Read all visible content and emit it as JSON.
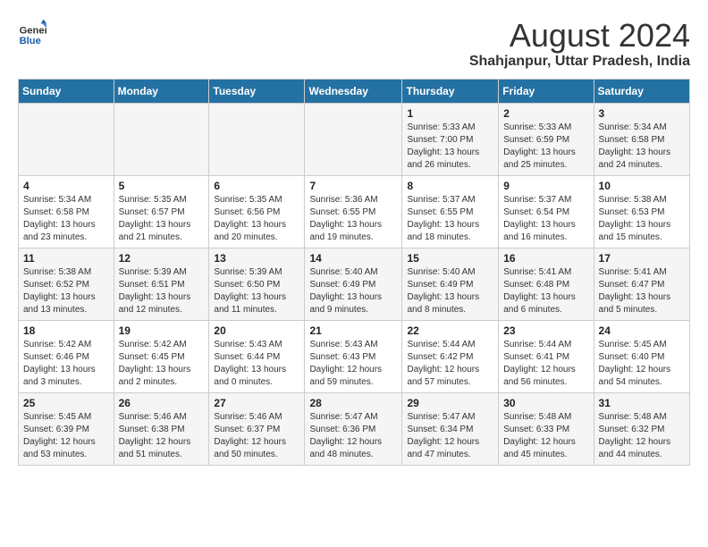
{
  "logo": {
    "text_general": "General",
    "text_blue": "Blue"
  },
  "title": "August 2024",
  "subtitle": "Shahjanpur, Uttar Pradesh, India",
  "days_of_week": [
    "Sunday",
    "Monday",
    "Tuesday",
    "Wednesday",
    "Thursday",
    "Friday",
    "Saturday"
  ],
  "weeks": [
    [
      {
        "day": "",
        "info": ""
      },
      {
        "day": "",
        "info": ""
      },
      {
        "day": "",
        "info": ""
      },
      {
        "day": "",
        "info": ""
      },
      {
        "day": "1",
        "info": "Sunrise: 5:33 AM\nSunset: 7:00 PM\nDaylight: 13 hours\nand 26 minutes."
      },
      {
        "day": "2",
        "info": "Sunrise: 5:33 AM\nSunset: 6:59 PM\nDaylight: 13 hours\nand 25 minutes."
      },
      {
        "day": "3",
        "info": "Sunrise: 5:34 AM\nSunset: 6:58 PM\nDaylight: 13 hours\nand 24 minutes."
      }
    ],
    [
      {
        "day": "4",
        "info": "Sunrise: 5:34 AM\nSunset: 6:58 PM\nDaylight: 13 hours\nand 23 minutes."
      },
      {
        "day": "5",
        "info": "Sunrise: 5:35 AM\nSunset: 6:57 PM\nDaylight: 13 hours\nand 21 minutes."
      },
      {
        "day": "6",
        "info": "Sunrise: 5:35 AM\nSunset: 6:56 PM\nDaylight: 13 hours\nand 20 minutes."
      },
      {
        "day": "7",
        "info": "Sunrise: 5:36 AM\nSunset: 6:55 PM\nDaylight: 13 hours\nand 19 minutes."
      },
      {
        "day": "8",
        "info": "Sunrise: 5:37 AM\nSunset: 6:55 PM\nDaylight: 13 hours\nand 18 minutes."
      },
      {
        "day": "9",
        "info": "Sunrise: 5:37 AM\nSunset: 6:54 PM\nDaylight: 13 hours\nand 16 minutes."
      },
      {
        "day": "10",
        "info": "Sunrise: 5:38 AM\nSunset: 6:53 PM\nDaylight: 13 hours\nand 15 minutes."
      }
    ],
    [
      {
        "day": "11",
        "info": "Sunrise: 5:38 AM\nSunset: 6:52 PM\nDaylight: 13 hours\nand 13 minutes."
      },
      {
        "day": "12",
        "info": "Sunrise: 5:39 AM\nSunset: 6:51 PM\nDaylight: 13 hours\nand 12 minutes."
      },
      {
        "day": "13",
        "info": "Sunrise: 5:39 AM\nSunset: 6:50 PM\nDaylight: 13 hours\nand 11 minutes."
      },
      {
        "day": "14",
        "info": "Sunrise: 5:40 AM\nSunset: 6:49 PM\nDaylight: 13 hours\nand 9 minutes."
      },
      {
        "day": "15",
        "info": "Sunrise: 5:40 AM\nSunset: 6:49 PM\nDaylight: 13 hours\nand 8 minutes."
      },
      {
        "day": "16",
        "info": "Sunrise: 5:41 AM\nSunset: 6:48 PM\nDaylight: 13 hours\nand 6 minutes."
      },
      {
        "day": "17",
        "info": "Sunrise: 5:41 AM\nSunset: 6:47 PM\nDaylight: 13 hours\nand 5 minutes."
      }
    ],
    [
      {
        "day": "18",
        "info": "Sunrise: 5:42 AM\nSunset: 6:46 PM\nDaylight: 13 hours\nand 3 minutes."
      },
      {
        "day": "19",
        "info": "Sunrise: 5:42 AM\nSunset: 6:45 PM\nDaylight: 13 hours\nand 2 minutes."
      },
      {
        "day": "20",
        "info": "Sunrise: 5:43 AM\nSunset: 6:44 PM\nDaylight: 13 hours\nand 0 minutes."
      },
      {
        "day": "21",
        "info": "Sunrise: 5:43 AM\nSunset: 6:43 PM\nDaylight: 12 hours\nand 59 minutes."
      },
      {
        "day": "22",
        "info": "Sunrise: 5:44 AM\nSunset: 6:42 PM\nDaylight: 12 hours\nand 57 minutes."
      },
      {
        "day": "23",
        "info": "Sunrise: 5:44 AM\nSunset: 6:41 PM\nDaylight: 12 hours\nand 56 minutes."
      },
      {
        "day": "24",
        "info": "Sunrise: 5:45 AM\nSunset: 6:40 PM\nDaylight: 12 hours\nand 54 minutes."
      }
    ],
    [
      {
        "day": "25",
        "info": "Sunrise: 5:45 AM\nSunset: 6:39 PM\nDaylight: 12 hours\nand 53 minutes."
      },
      {
        "day": "26",
        "info": "Sunrise: 5:46 AM\nSunset: 6:38 PM\nDaylight: 12 hours\nand 51 minutes."
      },
      {
        "day": "27",
        "info": "Sunrise: 5:46 AM\nSunset: 6:37 PM\nDaylight: 12 hours\nand 50 minutes."
      },
      {
        "day": "28",
        "info": "Sunrise: 5:47 AM\nSunset: 6:36 PM\nDaylight: 12 hours\nand 48 minutes."
      },
      {
        "day": "29",
        "info": "Sunrise: 5:47 AM\nSunset: 6:34 PM\nDaylight: 12 hours\nand 47 minutes."
      },
      {
        "day": "30",
        "info": "Sunrise: 5:48 AM\nSunset: 6:33 PM\nDaylight: 12 hours\nand 45 minutes."
      },
      {
        "day": "31",
        "info": "Sunrise: 5:48 AM\nSunset: 6:32 PM\nDaylight: 12 hours\nand 44 minutes."
      }
    ]
  ]
}
